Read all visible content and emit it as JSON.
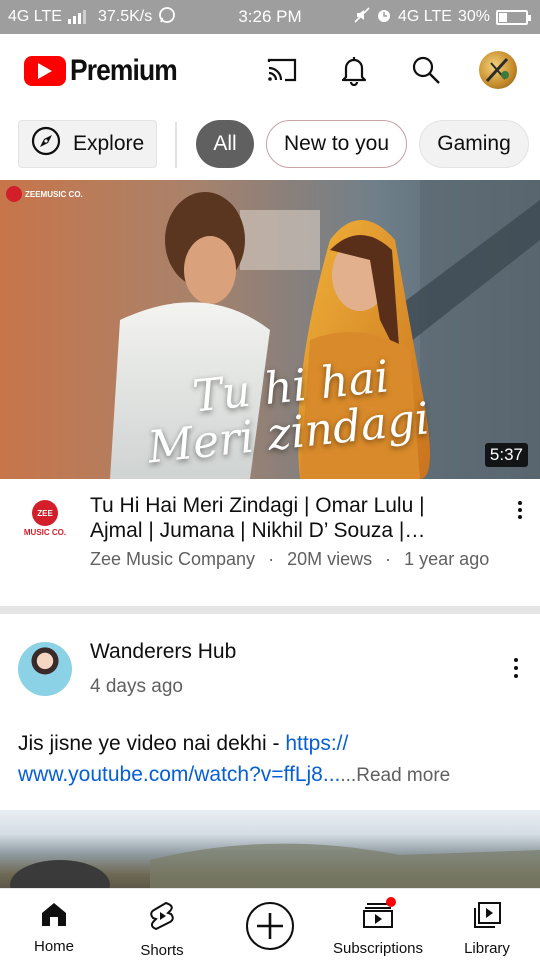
{
  "status_bar": {
    "network_left": "4G LTE",
    "speed": "37.5K/s",
    "time": "3:26 PM",
    "network_right": "4G LTE",
    "battery": "30%",
    "battery_level": 0.3
  },
  "header": {
    "logo_text": "Premium",
    "icons": [
      "cast-icon",
      "bell-icon",
      "search-icon",
      "account-avatar"
    ]
  },
  "chips": {
    "explore": "Explore",
    "items": [
      "All",
      "New to you",
      "Gaming"
    ],
    "selected": "All"
  },
  "video": {
    "duration": "5:37",
    "thumbnail_text_line1": "Tu hi hai",
    "thumbnail_text_line2": "Meri zindagi",
    "thumbnail_badge": "ZEEMUSIC CO.",
    "channel_logo_top": "ZEE",
    "channel_logo_bottom": "MUSIC CO.",
    "title": "Tu Hi Hai Meri Zindagi | Omar Lulu | Ajmal | Jumana | Nikhil D’ Souza |…",
    "channel": "Zee Music Company",
    "views": "20M views",
    "age": "1 year ago",
    "separator": "·"
  },
  "post": {
    "author": "Wanderers Hub",
    "time": "4 days ago",
    "text": "Jis jisne ye video nai dekhi - ",
    "link": "https://\nwww.youtube.com/watch?v=ffLj8...",
    "more_prefix": "...",
    "read_more": "Read more"
  },
  "bottom_nav": {
    "home": "Home",
    "shorts": "Shorts",
    "subscriptions": "Subscriptions",
    "library": "Library"
  },
  "colors": {
    "brand_red": "#ff0000",
    "link_blue": "#065fd4",
    "secondary_text": "#606060",
    "chip_selected": "#606060"
  }
}
